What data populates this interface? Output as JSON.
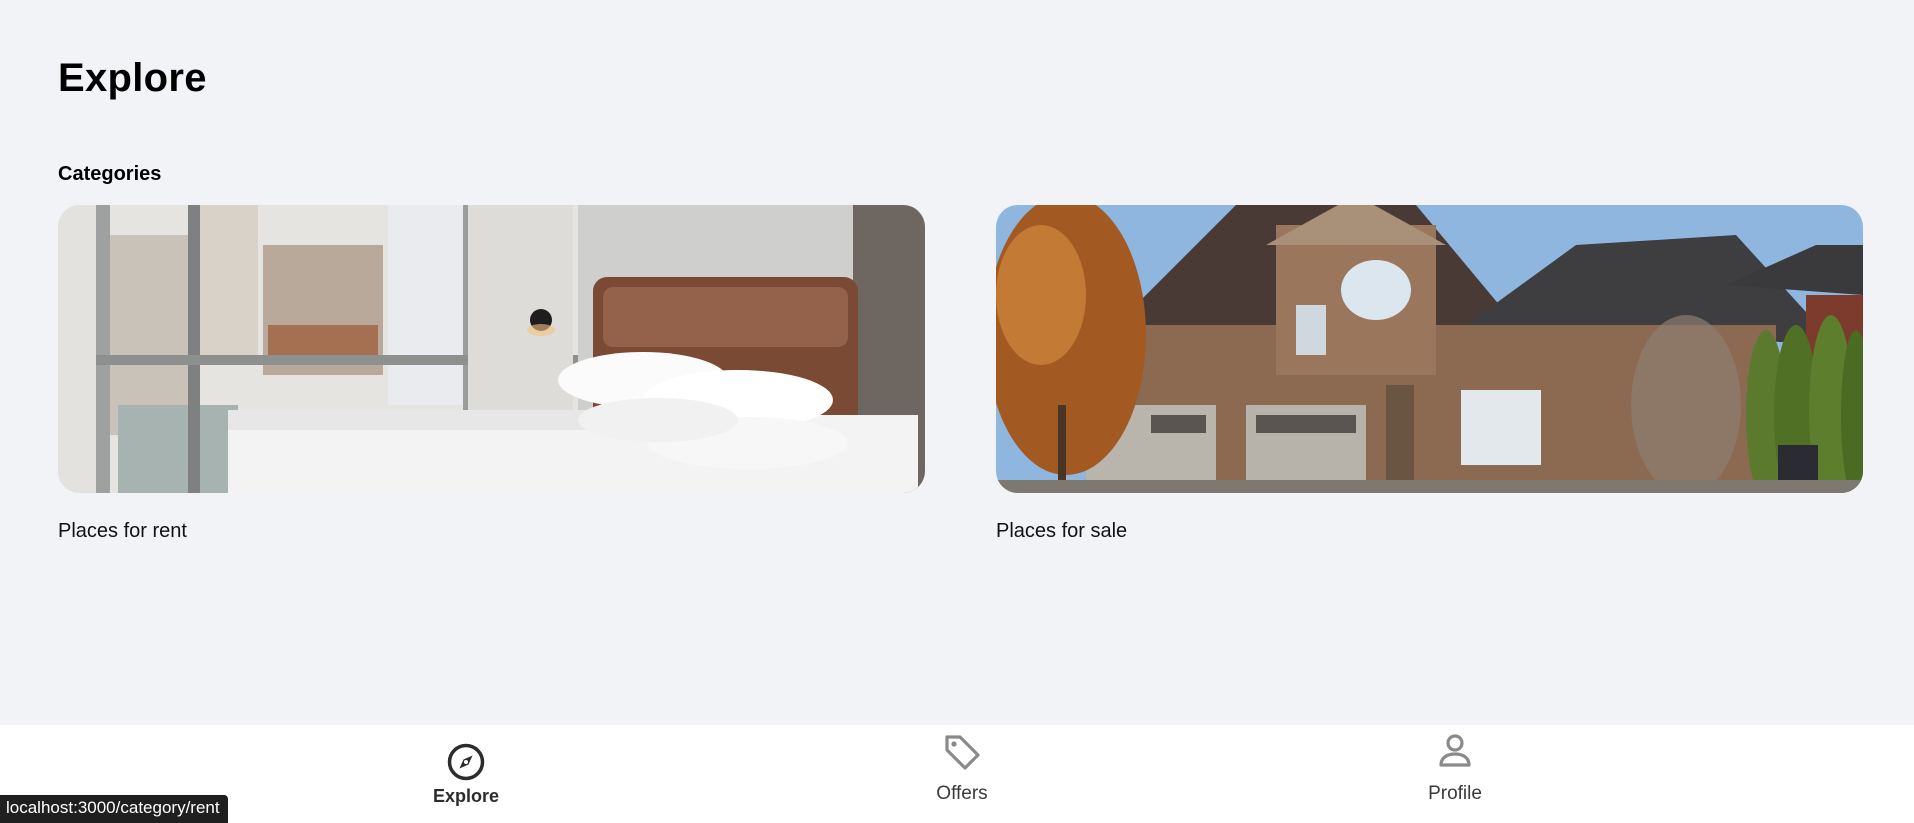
{
  "page": {
    "title": "Explore",
    "section_heading": "Categories"
  },
  "categories": [
    {
      "label": "Places for rent",
      "image": "bedroom-with-window-photo"
    },
    {
      "label": "Places for sale",
      "image": "brick-house-photo"
    }
  ],
  "bottom_nav": {
    "active": "Explore",
    "items": [
      {
        "label": "Explore",
        "icon": "compass-icon"
      },
      {
        "label": "Offers",
        "icon": "tag-icon"
      },
      {
        "label": "Profile",
        "icon": "person-icon"
      }
    ]
  },
  "status_bar": {
    "url": "localhost:3000/category/rent"
  },
  "colors": {
    "background": "#f2f3f7",
    "nav_background": "#ffffff",
    "active_icon": "#2c2c2c",
    "inactive_icon": "#8a8a8a"
  }
}
